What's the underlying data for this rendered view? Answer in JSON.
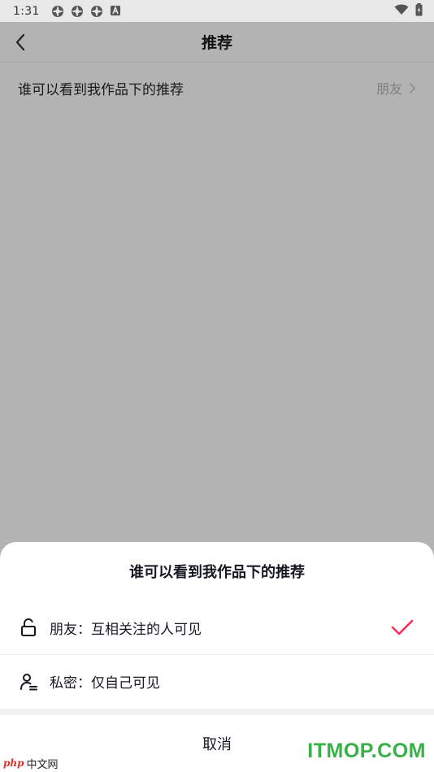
{
  "status_bar": {
    "time": "1:31",
    "notification_icons": [
      "pinwheel-icon",
      "pinwheel-icon",
      "pinwheel-icon",
      "app-a-icon"
    ],
    "right_icons": [
      "wifi-icon",
      "battery-icon"
    ]
  },
  "header": {
    "back_icon": "chevron-left-icon",
    "title": "推荐"
  },
  "setting": {
    "label": "谁可以看到我作品下的推荐",
    "value": "朋友",
    "chevron_icon": "chevron-right-icon"
  },
  "sheet": {
    "title": "谁可以看到我作品下的推荐",
    "options": [
      {
        "icon": "unlock-icon",
        "label": "朋友：互相关注的人可见",
        "selected": true
      },
      {
        "icon": "private-user-icon",
        "label": "私密：仅自己可见",
        "selected": false
      }
    ],
    "cancel_label": "取消"
  },
  "colors": {
    "overlay_bg": "#b3b3b3",
    "check": "#fe2c55",
    "watermark_green": "#37b04a",
    "watermark_red": "#e0322b"
  },
  "watermarks": {
    "left_logo": "php",
    "left_text": "中文网",
    "right_text": "ITMOP.COM"
  }
}
